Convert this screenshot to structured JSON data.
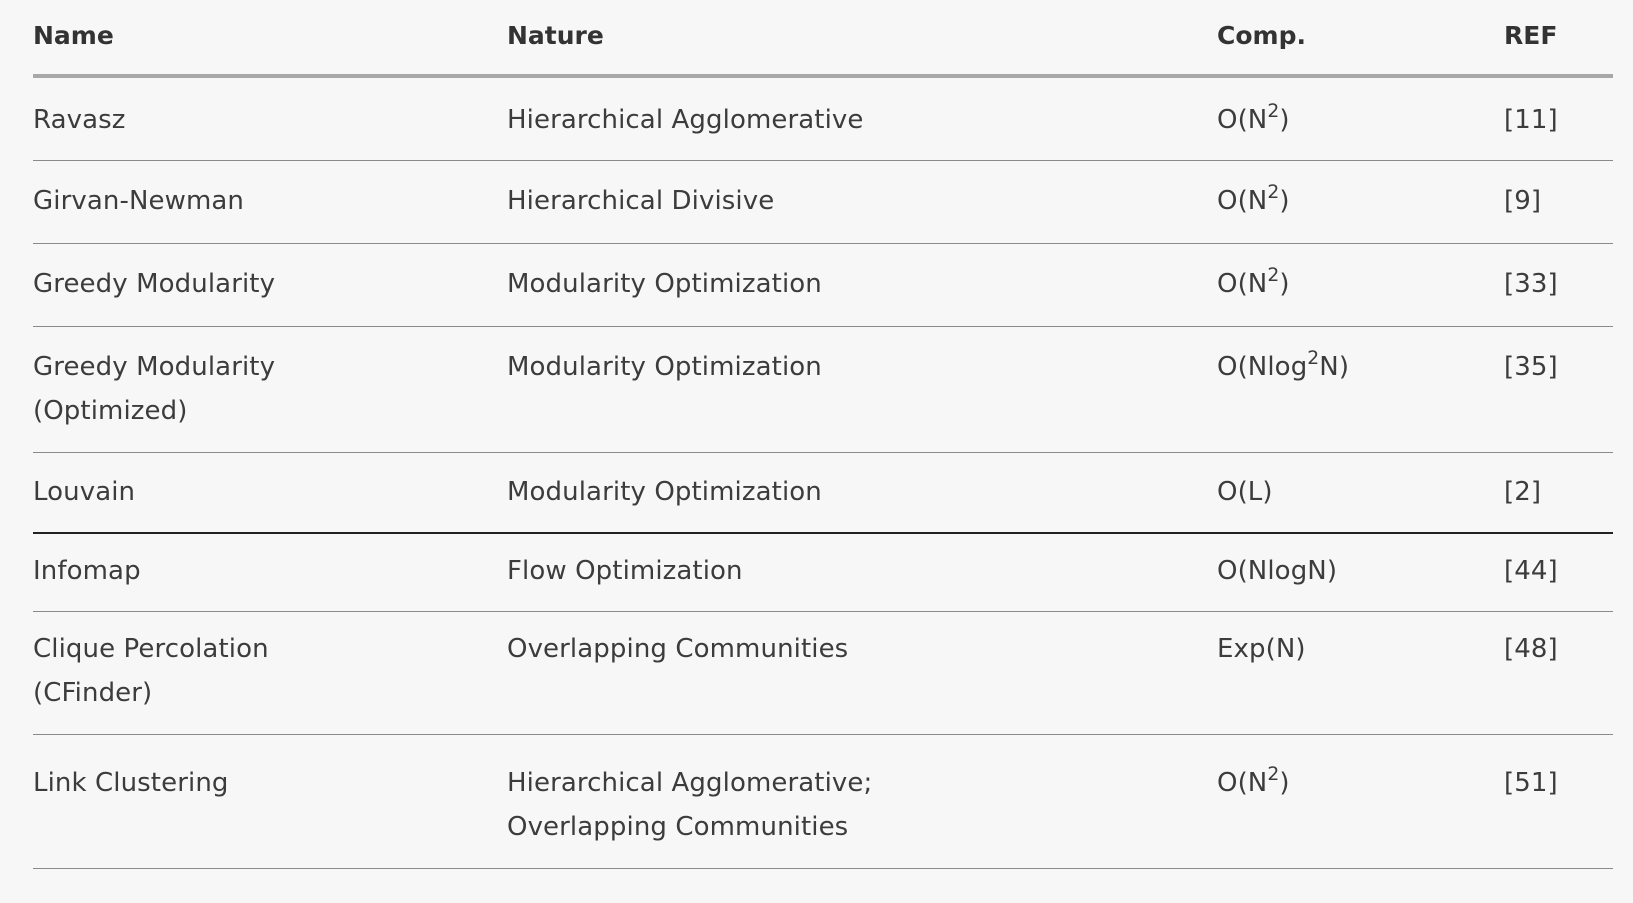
{
  "table": {
    "headers": {
      "name": "Name",
      "nature": "Nature",
      "comp": "Comp.",
      "ref": "REF"
    },
    "rows": [
      {
        "name_lines": [
          "Ravasz"
        ],
        "nature_lines": [
          "Hierarchical Agglomerative"
        ],
        "comp": {
          "before": "O(N",
          "sup": "2",
          "after": ")"
        },
        "ref": "[11]"
      },
      {
        "name_lines": [
          "Girvan-Newman"
        ],
        "nature_lines": [
          "Hierarchical Divisive"
        ],
        "comp": {
          "before": "O(N",
          "sup": "2",
          "after": ")"
        },
        "ref": "[9]"
      },
      {
        "name_lines": [
          "Greedy Modularity"
        ],
        "nature_lines": [
          "Modularity Optimization"
        ],
        "comp": {
          "before": "O(N",
          "sup": "2",
          "after": ")"
        },
        "ref": "[33]"
      },
      {
        "name_lines": [
          "Greedy Modularity",
          "(Optimized)"
        ],
        "nature_lines": [
          "Modularity Optimization"
        ],
        "comp": {
          "before": "O(Nlog",
          "sup": "2",
          "after": "N)"
        },
        "ref": "[35]"
      },
      {
        "name_lines": [
          "Louvain"
        ],
        "nature_lines": [
          "Modularity Optimization"
        ],
        "comp": {
          "before": "O(L)",
          "sup": "",
          "after": ""
        },
        "ref": "[2]"
      },
      {
        "name_lines": [
          "Infomap"
        ],
        "nature_lines": [
          "Flow Optimization"
        ],
        "comp": {
          "before": "O(NlogN)",
          "sup": "",
          "after": ""
        },
        "ref": "[44]"
      },
      {
        "name_lines": [
          "Clique Percolation",
          "(CFinder)"
        ],
        "nature_lines": [
          "Overlapping Communities"
        ],
        "comp": {
          "before": "Exp(N)",
          "sup": "",
          "after": ""
        },
        "ref": "[48]"
      },
      {
        "name_lines": [
          "Link Clustering"
        ],
        "nature_lines": [
          "Hierarchical Agglomerative;",
          "Overlapping Communities"
        ],
        "comp": {
          "before": "O(N",
          "sup": "2",
          "after": ")"
        },
        "ref": "[51]"
      }
    ]
  }
}
